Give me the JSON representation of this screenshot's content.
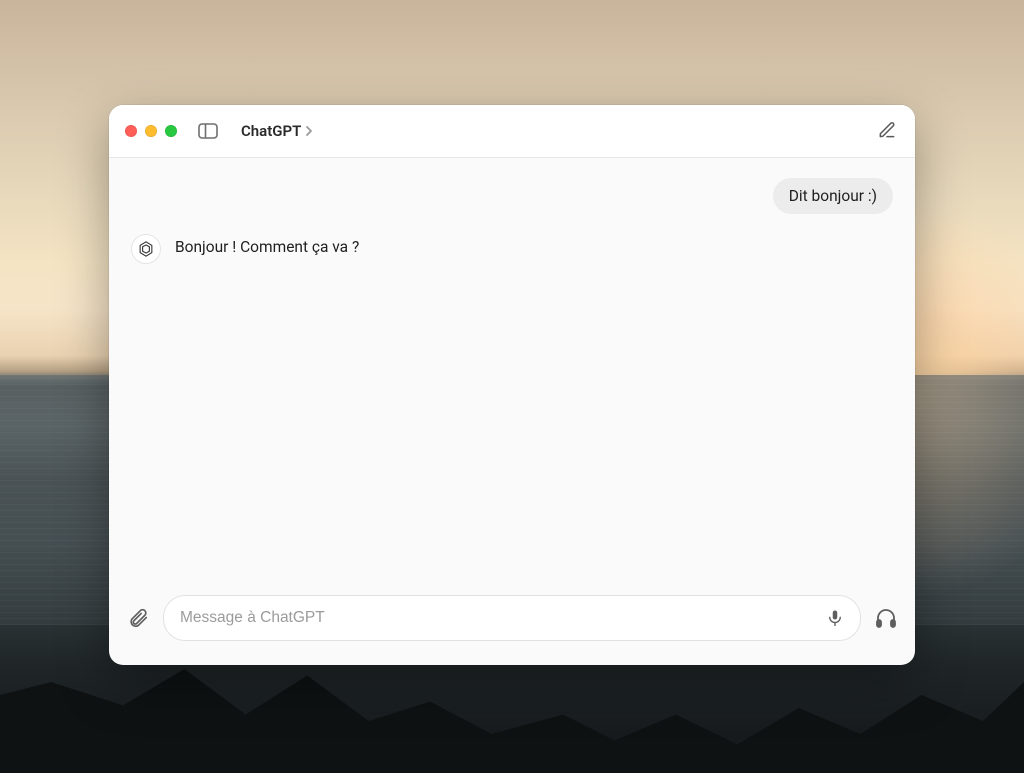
{
  "window": {
    "title": "ChatGPT"
  },
  "chat": {
    "user_message": "Dit bonjour :)",
    "assistant_message": "Bonjour ! Comment ça va ?"
  },
  "composer": {
    "placeholder": "Message à ChatGPT",
    "value": ""
  },
  "icons": {
    "sidebar_toggle": "sidebar-toggle-icon",
    "chevron": "chevron-right-icon",
    "compose": "compose-icon",
    "attach": "paperclip-icon",
    "mic": "microphone-icon",
    "headphones": "headphones-icon",
    "assistant_avatar": "openai-logo-icon"
  }
}
